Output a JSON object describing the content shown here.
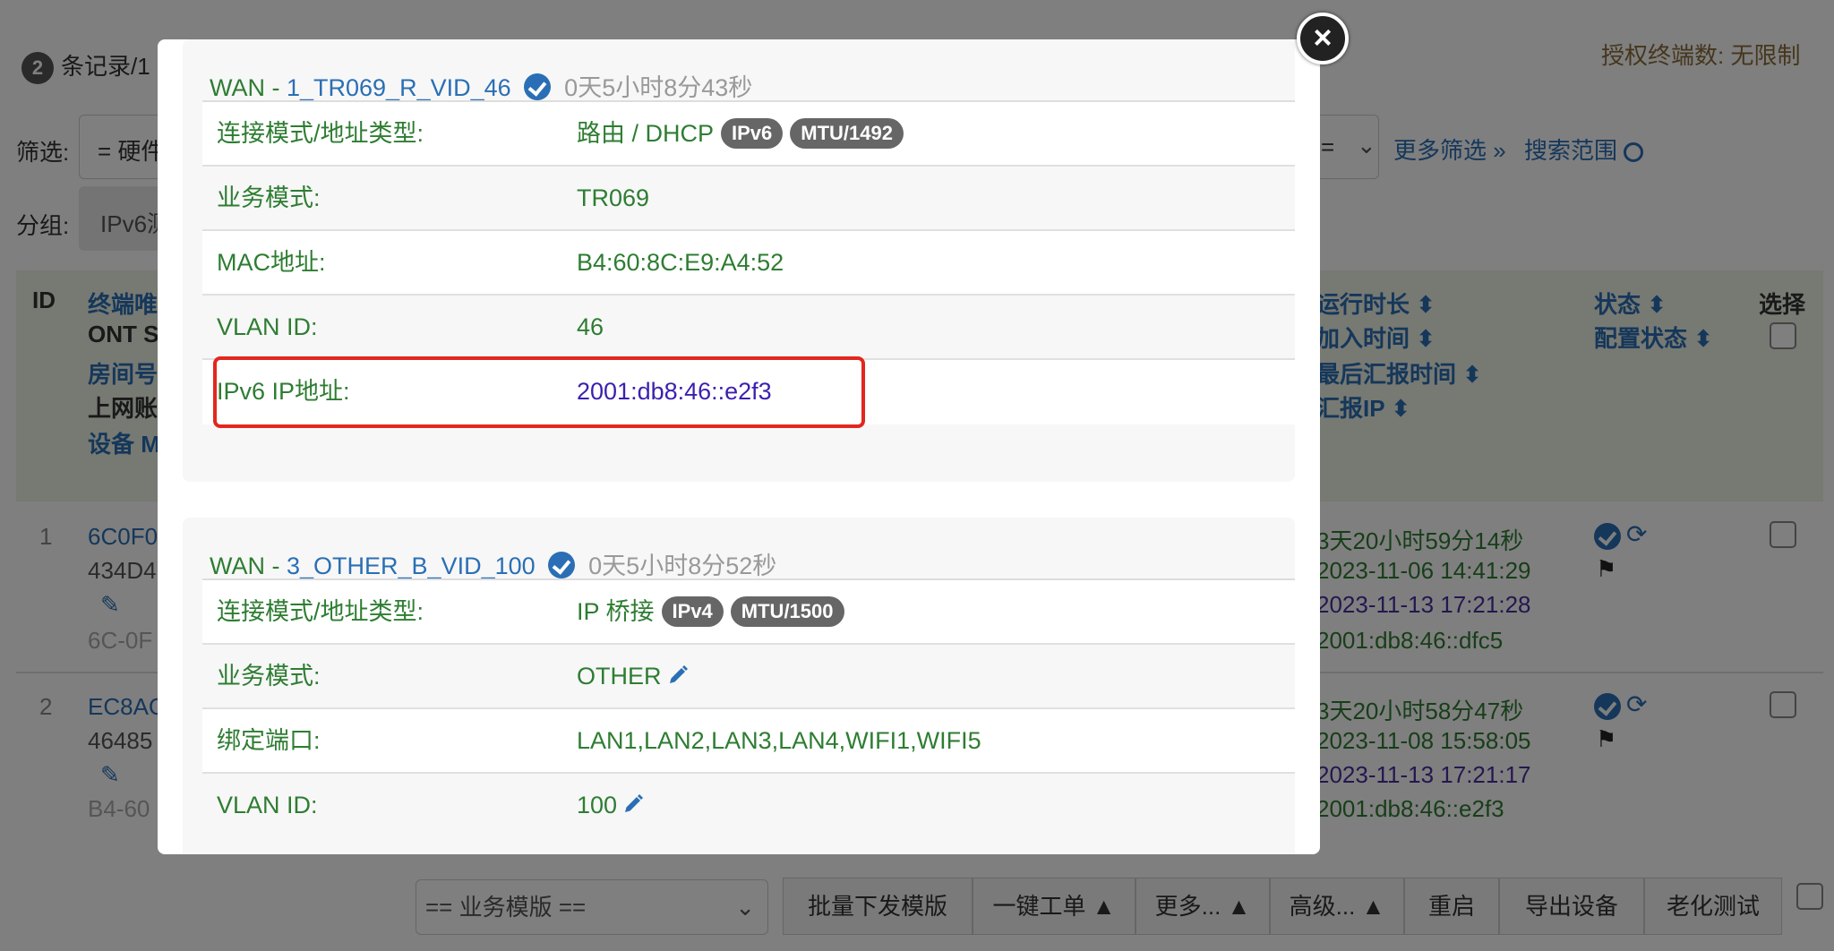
{
  "background": {
    "record_count": "2",
    "record_text": "条记录/1",
    "authorized_terminals": "授权终端数: 无限制",
    "filter_label": "筛选:",
    "filter_value": "= 硬件",
    "filter_right_value": "=",
    "more_filters": "更多筛选 »",
    "search_scope": "搜索范围",
    "group_label": "分组:",
    "group_value": "IPv6测",
    "table_headers": {
      "id": "ID",
      "terminal": "终端唯",
      "ont": "ONT S",
      "room": "房间号",
      "account": "上网账",
      "device": "设备 M",
      "runtime": "运行时长 ⬍",
      "join_time": "加入时间 ⬍",
      "last_report": "最后汇报时间 ⬍",
      "report_ip": "汇报IP ⬍",
      "status": "状态 ⬍",
      "config_status": "配置状态 ⬍",
      "select": "选择"
    },
    "rows": [
      {
        "id": "1",
        "terminal": "6C0F0",
        "serial": "434D4",
        "mac": "6C-0F",
        "runtime": "3天20小时59分14秒",
        "join_time": "2023-11-06 14:41:29",
        "last_report": "2023-11-13 17:21:28",
        "report_ip": "2001:db8:46::dfc5"
      },
      {
        "id": "2",
        "terminal": "EC8AC",
        "serial": "46485",
        "mac": "B4-60",
        "runtime": "3天20小时58分47秒",
        "join_time": "2023-11-08 15:58:05",
        "last_report": "2023-11-13 17:21:17",
        "report_ip": "2001:db8:46::e2f3"
      }
    ],
    "template_select": "== 业务模版 ==",
    "buttons": {
      "batch": "批量下发模版",
      "one_click": "一键工单 ▲",
      "more": "更多... ▲",
      "advanced": "高级... ▲",
      "reboot": "重启",
      "export": "导出设备",
      "aging": "老化测试"
    }
  },
  "modal": {
    "close_symbol": "×",
    "wans": [
      {
        "prefix": "WAN - ",
        "name": "1_TR069_R_VID_46",
        "uptime": "0天5小时8分43秒",
        "rows": [
          {
            "key": "连接模式/地址类型:",
            "value": "路由 / DHCP",
            "tags": [
              "IPv6",
              "MTU/1492"
            ]
          },
          {
            "key": "业务模式:",
            "value": "TR069"
          },
          {
            "key": "MAC地址:",
            "value": "B4:60:8C:E9:A4:52"
          },
          {
            "key": "VLAN ID:",
            "value": "46"
          },
          {
            "key": "IPv6 IP地址:",
            "value": "2001:db8:46::e2f3"
          }
        ]
      },
      {
        "prefix": "WAN - ",
        "name": "3_OTHER_B_VID_100",
        "uptime": "0天5小时8分52秒",
        "rows": [
          {
            "key": "连接模式/地址类型:",
            "value": "IP 桥接",
            "tags": [
              "IPv4",
              "MTU/1500"
            ]
          },
          {
            "key": "业务模式:",
            "value": "OTHER"
          },
          {
            "key": "绑定端口:",
            "value": "LAN1,LAN2,LAN3,LAN4,WIFI1,WIFI5"
          },
          {
            "key": "VLAN ID:",
            "value": "100"
          }
        ]
      }
    ]
  }
}
